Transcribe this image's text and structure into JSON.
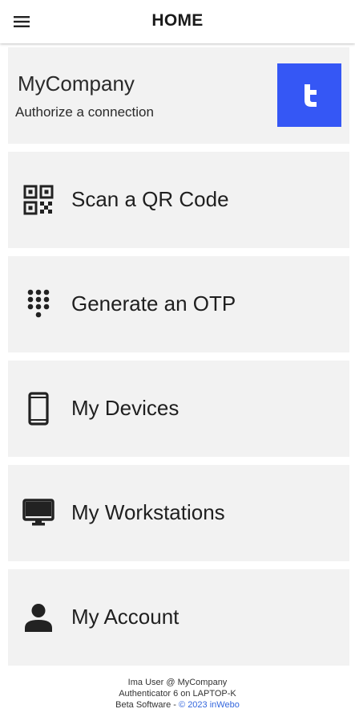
{
  "header": {
    "title": "HOME"
  },
  "company": {
    "name": "MyCompany",
    "subtitle": "Authorize a connection"
  },
  "menu_items": [
    {
      "label": "Scan a QR Code",
      "icon": "qr-code-icon"
    },
    {
      "label": "Generate an OTP",
      "icon": "dialpad-icon"
    },
    {
      "label": "My Devices",
      "icon": "smartphone-icon"
    },
    {
      "label": "My Workstations",
      "icon": "desktop-icon"
    },
    {
      "label": "My Account",
      "icon": "person-icon"
    }
  ],
  "footer": {
    "user": "Ima User @ MyCompany",
    "app": "Authenticator 6 on LAPTOP-K",
    "beta": "Beta Software - ",
    "copyright": "© 2023 inWebo"
  },
  "colors": {
    "logo_bg": "#3557f5",
    "card_bg": "#f2f2f2",
    "link": "#3366dd"
  }
}
